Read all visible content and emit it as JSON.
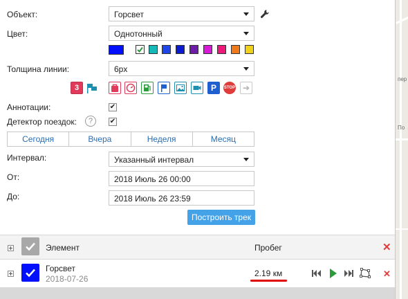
{
  "form": {
    "object_label": "Объект:",
    "object_value": "Горсвет",
    "color_label": "Цвет:",
    "color_value": "Однотонный",
    "palette": [
      "#0010ff",
      "#ffffff",
      "#16b8b8",
      "#1e46e8",
      "#0a1bd0",
      "#6d1da8",
      "#d81ad8",
      "#ee1a7a",
      "#f07a1a",
      "#f1d21a"
    ],
    "line_width_label": "Толщина линии:",
    "line_width_value": "6px",
    "annotations_label": "Аннотации:",
    "trip_detector_label": "Детектор поездок:",
    "help_glyph": "?",
    "tabs": [
      "Сегодня",
      "Вчера",
      "Неделя",
      "Месяц"
    ],
    "interval_label": "Интервал:",
    "interval_value": "Указанный интервал",
    "from_label": "От:",
    "from_value": "2018 Июль 26 00:00",
    "to_label": "До:",
    "to_value": "2018 Июль 26 23:59",
    "build_button": "Построить трек"
  },
  "marker_icons": [
    {
      "name": "number-3-icon",
      "glyph": "3",
      "color": "#e03b5a"
    },
    {
      "name": "flag-icon",
      "glyph": "",
      "color": "#1f8fb0"
    },
    {
      "name": "bag-icon",
      "glyph": "",
      "color": "#e03b5a"
    },
    {
      "name": "gauge-icon",
      "glyph": "",
      "color": "#e03b5a"
    },
    {
      "name": "fuel-icon",
      "glyph": "",
      "color": "#2a9a3a"
    },
    {
      "name": "blue-flag-icon",
      "glyph": "",
      "color": "#1f5fd0"
    },
    {
      "name": "image-icon",
      "glyph": "",
      "color": "#1f8fb0"
    },
    {
      "name": "camera-icon",
      "glyph": "",
      "color": "#1f8fb0"
    },
    {
      "name": "parking-icon",
      "glyph": "P",
      "color": "#1f5fd0"
    },
    {
      "name": "stop-icon",
      "glyph": "STOP",
      "color": "#e03b3b"
    },
    {
      "name": "arrow-right-icon",
      "glyph": "➔",
      "color": "#b0b0b0"
    }
  ],
  "table": {
    "header_element": "Элемент",
    "header_mileage": "Пробег",
    "rows": [
      {
        "name": "Горсвет",
        "date": "2018-07-26",
        "mileage": "2.19 км"
      }
    ]
  },
  "map_texts": [
    "пер",
    "По"
  ],
  "colors": {
    "accent": "#43a2e8",
    "tab_text": "#2a6db0",
    "delete": "#e03b3b",
    "play": "#2a9a3a",
    "underline": "#e00000"
  }
}
